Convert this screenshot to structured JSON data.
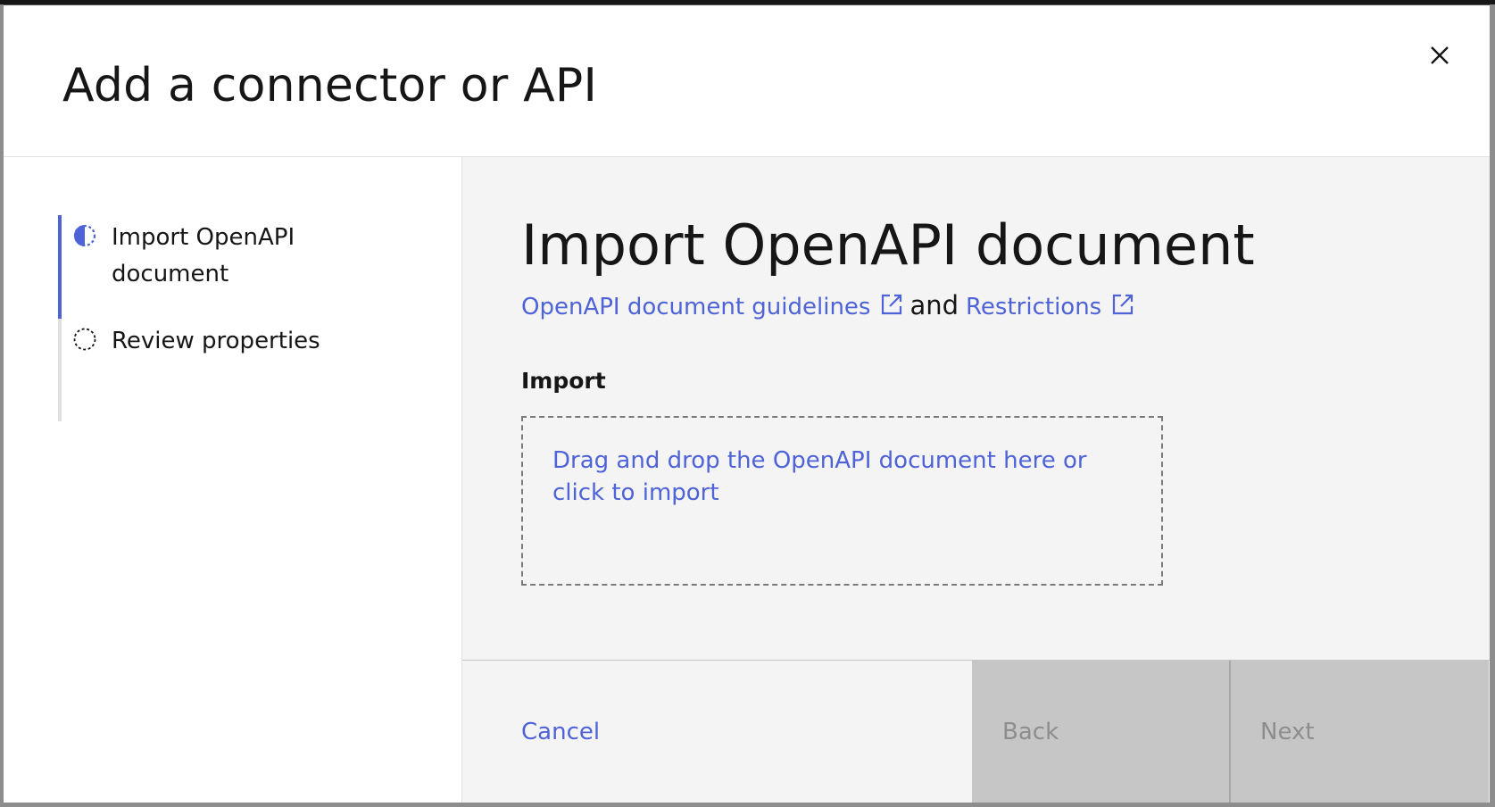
{
  "modal": {
    "title": "Add a connector or API",
    "close_icon": "close-icon"
  },
  "steps": [
    {
      "label": "Import OpenAPI document",
      "state": "current",
      "icon": "half-filled-circle-icon"
    },
    {
      "label": "Review properties",
      "state": "incomplete",
      "icon": "dashed-circle-icon"
    }
  ],
  "content": {
    "title": "Import OpenAPI document",
    "guidelines_link": "OpenAPI document guidelines",
    "and_text": "and",
    "restrictions_link": "Restrictions",
    "external_link_icon": "external-link-icon",
    "import_label": "Import",
    "dropzone_text": "Drag and drop the OpenAPI document here or click to import"
  },
  "footer": {
    "cancel_label": "Cancel",
    "back_label": "Back",
    "next_label": "Next"
  },
  "colors": {
    "accent": "#4f63d8",
    "text": "#161616",
    "content_bg": "#f4f4f4",
    "disabled_bg": "#c6c6c6",
    "disabled_text": "#8d8d8d"
  }
}
